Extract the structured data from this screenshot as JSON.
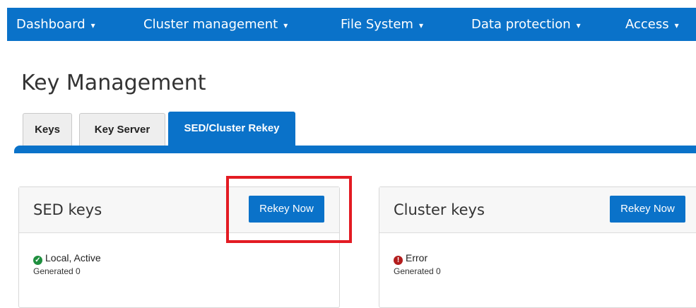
{
  "nav": {
    "items": [
      {
        "label": "Dashboard"
      },
      {
        "label": "Cluster management"
      },
      {
        "label": "File System"
      },
      {
        "label": "Data protection"
      },
      {
        "label": "Access"
      }
    ],
    "caret": "▾"
  },
  "page": {
    "title": "Key Management"
  },
  "tabs": [
    {
      "label": "Keys",
      "active": false
    },
    {
      "label": "Key Server",
      "active": false
    },
    {
      "label": "SED/Cluster Rekey",
      "active": true
    }
  ],
  "panels": {
    "sed": {
      "title": "SED keys",
      "button": "Rekey Now",
      "status": "Local, Active",
      "status_icon": "check-circle-icon",
      "generated": "Generated 0"
    },
    "cluster": {
      "title": "Cluster keys",
      "button": "Rekey Now",
      "status": "Error",
      "status_icon": "error-circle-icon",
      "generated": "Generated 0"
    }
  },
  "colors": {
    "accent": "#0a72c9",
    "ok": "#1e8e3e",
    "error": "#b31d1d",
    "highlight": "#e31b23"
  }
}
